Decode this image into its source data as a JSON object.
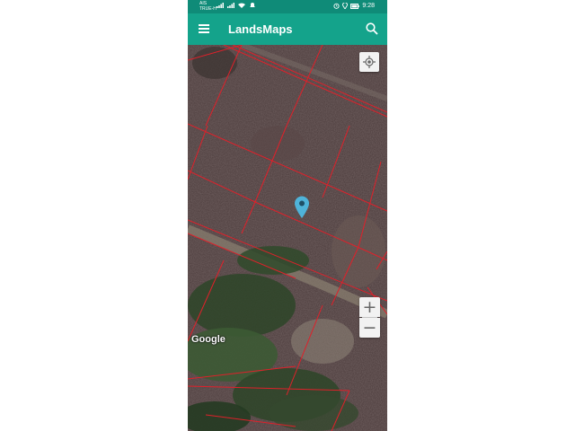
{
  "status_bar": {
    "carrier_line1": "AIS",
    "carrier_line2": "TRUE-H",
    "time": "9:28"
  },
  "app_bar": {
    "title": "LandsMaps",
    "menu_icon": "hamburger-menu-icon",
    "search_icon": "search-icon"
  },
  "map": {
    "attribution": "Google",
    "zoom_in_label": "+",
    "zoom_out_label": "−",
    "my_location_icon": "my-location-icon",
    "marker_icon": "map-pin-icon",
    "marker_color": "#4fb3d9",
    "parcel_line_color": "#e0202a"
  },
  "colors": {
    "statusbar": "#0f8b78",
    "appbar": "#14a38b"
  }
}
